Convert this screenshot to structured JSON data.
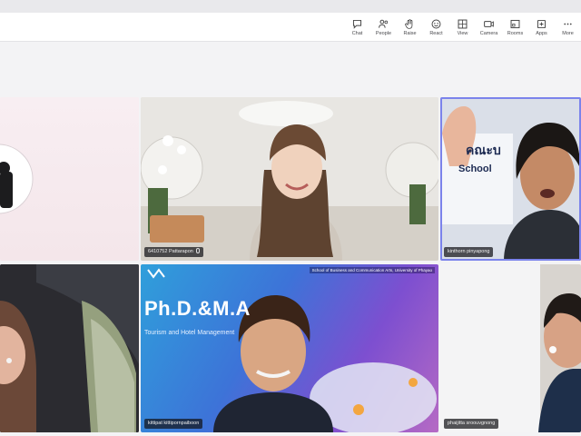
{
  "toolbar": {
    "items": [
      {
        "label": "Chat",
        "icon": "chat-icon"
      },
      {
        "label": "People",
        "icon": "people-icon"
      },
      {
        "label": "Raise",
        "icon": "raise-hand-icon"
      },
      {
        "label": "React",
        "icon": "react-icon"
      },
      {
        "label": "View",
        "icon": "view-icon"
      },
      {
        "label": "Camera",
        "icon": "camera-icon"
      },
      {
        "label": "Rooms",
        "icon": "rooms-icon"
      },
      {
        "label": "Apps",
        "icon": "apps-icon"
      },
      {
        "label": "More",
        "icon": "more-icon"
      }
    ]
  },
  "participants": [
    {
      "name": ""
    },
    {
      "name": "6410752 Pattarapon"
    },
    {
      "name": "kinthorn pinyapong",
      "active": true
    },
    {
      "name": ""
    },
    {
      "name": "kittipat kittipornpaiboon"
    },
    {
      "name": "phaijitta sroouvgnong"
    }
  ],
  "slide": {
    "title": "Ph.D.&M.A",
    "subtitle": "Tourism and Hotel Management",
    "header": "School of Business and Communication Arts, University of Phayao"
  },
  "background_text": {
    "school": "School",
    "thai": "คณะบ"
  },
  "colors": {
    "accent": "#7b83eb",
    "toolbar_bg": "#ffffff",
    "stage_bg": "#f3f3f5"
  }
}
